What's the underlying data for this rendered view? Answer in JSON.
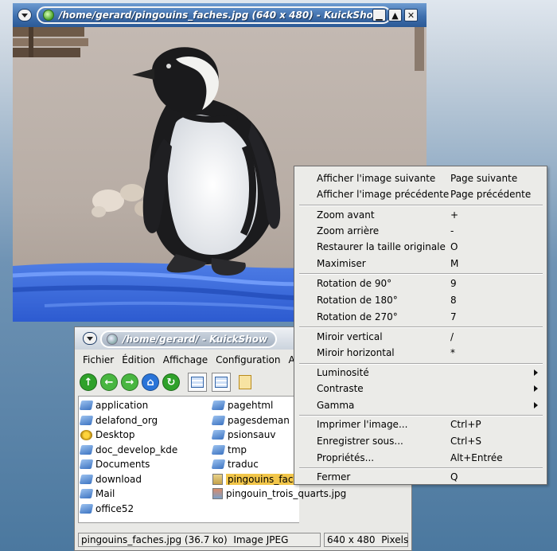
{
  "viewer": {
    "title": "/home/gerard/pingouins_faches.jpg (640 x 480) - KuickShow",
    "buttons": {
      "minimize": "▁",
      "maximize": "▲",
      "close": "✕"
    }
  },
  "browser": {
    "title": "/home/gerard/ - KuickShow",
    "menu": [
      "Fichier",
      "Édition",
      "Affichage",
      "Configuration",
      "Ai"
    ],
    "files_left": [
      "application",
      "delafond_org",
      "Desktop",
      "doc_develop_kde",
      "Documents",
      "download",
      "Mail",
      "office52"
    ],
    "files_right": [
      "pagehtml",
      "pagesdeman",
      "psionsauv",
      "tmp",
      "traduc",
      "pingouins_fac",
      "pingouin_trois_quarts.jpg"
    ],
    "toolbar_icons": [
      "up-arrow-icon",
      "back-arrow-icon",
      "forward-arrow-icon",
      "home-icon",
      "reload-icon",
      "icon-view-icon",
      "list-view-icon",
      "slideshow-icon"
    ],
    "status": {
      "file": "pingouins_faches.jpg (36.7 ko)",
      "type": "Image JPEG",
      "dims": "640 x 480",
      "unit": "Pixels"
    }
  },
  "context_menu": {
    "items": [
      {
        "label": "Afficher l'image suivante",
        "shortcut": "Page suivante"
      },
      {
        "label": "Afficher l'image précédente",
        "shortcut": "Page précédente"
      },
      {
        "label": "Zoom avant",
        "shortcut": "+"
      },
      {
        "label": "Zoom arrière",
        "shortcut": "-"
      },
      {
        "label": "Restaurer la taille originale",
        "shortcut": "O"
      },
      {
        "label": "Maximiser",
        "shortcut": "M"
      },
      {
        "label": "Rotation de 90°",
        "shortcut": "9"
      },
      {
        "label": "Rotation de 180°",
        "shortcut": "8"
      },
      {
        "label": "Rotation de 270°",
        "shortcut": "7"
      },
      {
        "label": "Miroir vertical",
        "shortcut": "/"
      },
      {
        "label": "Miroir horizontal",
        "shortcut": "*"
      },
      {
        "label": "Luminosité",
        "shortcut": ""
      },
      {
        "label": "Contraste",
        "shortcut": ""
      },
      {
        "label": "Gamma",
        "shortcut": ""
      },
      {
        "label": "Imprimer l'image...",
        "shortcut": "Ctrl+P"
      },
      {
        "label": "Enregistrer sous...",
        "shortcut": "Ctrl+S"
      },
      {
        "label": "Propriétés...",
        "shortcut": "Alt+Entrée"
      },
      {
        "label": "Fermer",
        "shortcut": "Q"
      }
    ]
  }
}
